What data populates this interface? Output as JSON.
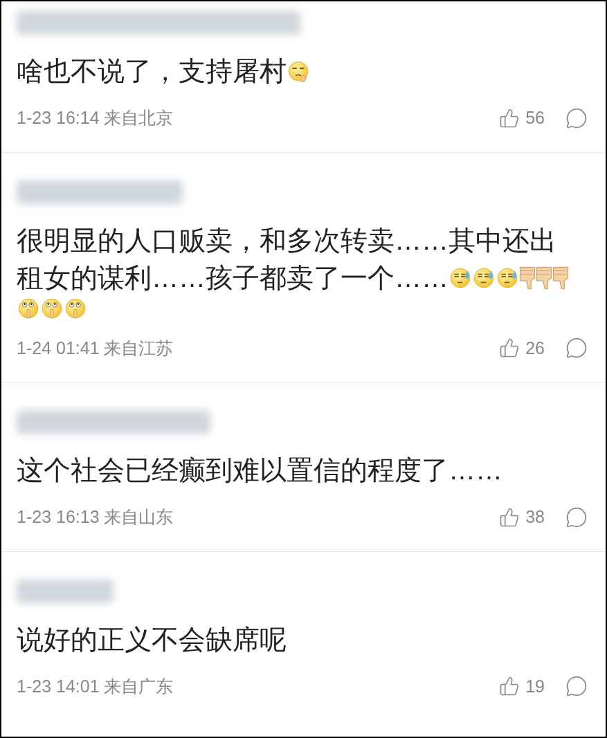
{
  "comments": [
    {
      "lines": [
        "啥也不说了，支持屠村"
      ],
      "emojis": [
        {
          "kind": "side-eye"
        }
      ],
      "time": "1-23 16:14 来自北京",
      "likes": "56"
    },
    {
      "lines": [
        "很明显的人口贩卖，和多次转卖……其中还出",
        "租女的谋利……孩子都卖了一个……"
      ],
      "emojis": [
        {
          "kind": "sweat"
        },
        {
          "kind": "sweat"
        },
        {
          "kind": "sweat"
        },
        {
          "kind": "thumbs-down"
        },
        {
          "kind": "thumbs-down"
        },
        {
          "kind": "thumbs-down"
        },
        {
          "kind": "shush"
        },
        {
          "kind": "shush"
        },
        {
          "kind": "shush"
        }
      ],
      "time": "1-24 01:41 来自江苏",
      "likes": "26"
    },
    {
      "lines": [
        "这个社会已经癫到难以置信的程度了……"
      ],
      "time": "1-23 16:13 来自山东",
      "likes": "38"
    },
    {
      "lines": [
        "说好的正义不会缺席呢"
      ],
      "time": "1-23 14:01 来自广东",
      "likes": "19"
    }
  ]
}
